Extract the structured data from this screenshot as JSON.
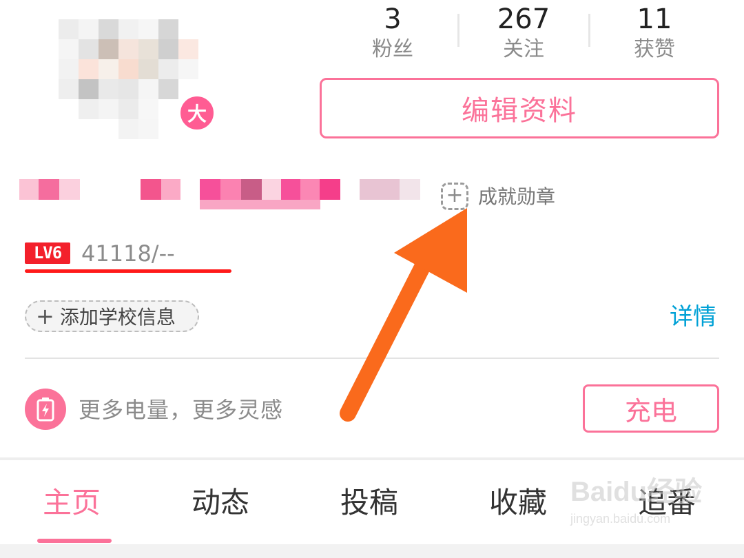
{
  "profile": {
    "avatar_badge": "大",
    "stats": [
      {
        "value": "3",
        "label": "粉丝"
      },
      {
        "value": "267",
        "label": "关注"
      },
      {
        "value": "11",
        "label": "获赞"
      }
    ],
    "edit_button": "编辑资料",
    "badge_label": "成就勋章",
    "badge_add_icon": "+",
    "level": {
      "badge": "LV6",
      "value": "41118/--"
    },
    "school": {
      "plus": "+",
      "label": "添加学校信息"
    },
    "details_link": "详情"
  },
  "charge": {
    "text": "更多电量，更多灵感",
    "button": "充电",
    "icon": "battery-bolt-icon"
  },
  "tabs": [
    {
      "label": "主页",
      "active": true
    },
    {
      "label": "动态",
      "active": false
    },
    {
      "label": "投稿",
      "active": false
    },
    {
      "label": "收藏",
      "active": false
    },
    {
      "label": "追番",
      "active": false
    }
  ],
  "watermark": {
    "logo": "Baidu经验",
    "url": "jingyan.baidu.com"
  },
  "colors": {
    "accent": "#fb7299",
    "link": "#00a1d6",
    "level": "#f3202b",
    "arrow": "#fa6a1c"
  }
}
